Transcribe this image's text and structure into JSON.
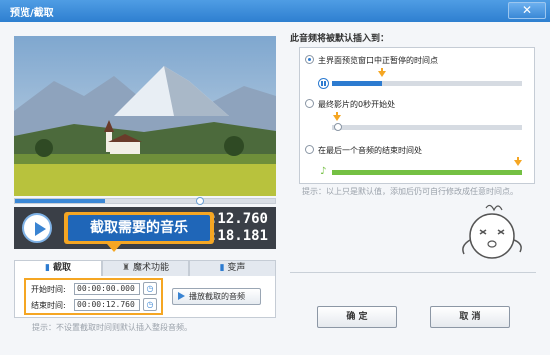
{
  "window": {
    "title": "预览/截取",
    "close_glyph": "✕"
  },
  "player": {
    "timecode_current": "00:00:12.760",
    "timecode_total": "00:00:18.181",
    "progress": 0.35
  },
  "callout": {
    "text": "截取需要的音乐"
  },
  "tabs": [
    {
      "label": "截取",
      "icon": "scissors-icon"
    },
    {
      "label": "魔术功能",
      "icon": "magic-hat-icon"
    },
    {
      "label": "变声",
      "icon": "voice-icon"
    }
  ],
  "clip": {
    "start_label": "开始时间:",
    "start_value": "00:00:00.000",
    "end_label": "结束时间:",
    "end_value": "00:00:12.760",
    "play_button": "播放截取的音频"
  },
  "hint_left": "提示：不设置截取时间则默认插入整段音频。",
  "insert_options": {
    "title": "此音频将被默认插入到：",
    "options": [
      {
        "label": "主界面预览窗口中正暂停的时间点",
        "selected": true
      },
      {
        "label": "最终影片的0秒开始处",
        "selected": false
      },
      {
        "label": "在最后一个音频的结束时间处",
        "selected": false
      }
    ],
    "hint": "提示：以上只是默认值，添加后仍可自行修改成任意时间点。"
  },
  "buttons": {
    "ok": "确 定",
    "cancel": "取 消"
  },
  "colors": {
    "accent": "#2d7bd0",
    "highlight": "#f5a623",
    "green": "#74c043"
  }
}
